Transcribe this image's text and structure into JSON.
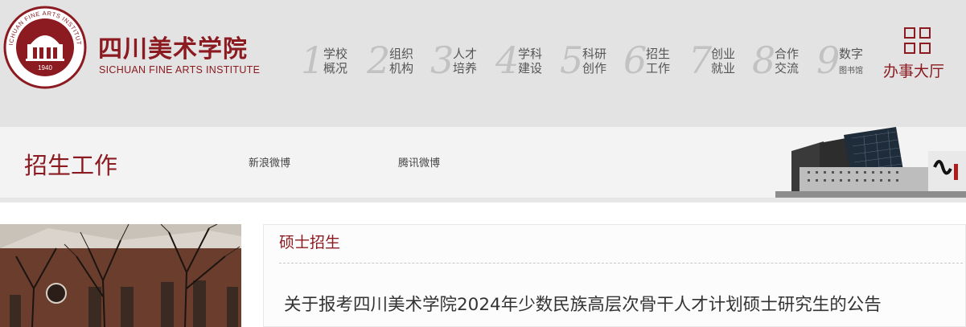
{
  "header": {
    "seal": {
      "year": "1940",
      "ring_text": "SICHUAN FINE ARTS INSTITUTE"
    },
    "logo_cn": "四川美术学院",
    "logo_en": "SICHUAN FINE ARTS INSTITUTE",
    "nav": [
      {
        "num": "1",
        "line1": "学校",
        "line2": "概况"
      },
      {
        "num": "2",
        "line1": "组织",
        "line2": "机构"
      },
      {
        "num": "3",
        "line1": "人才",
        "line2": "培养"
      },
      {
        "num": "4",
        "line1": "学科",
        "line2": "建设"
      },
      {
        "num": "5",
        "line1": "科研",
        "line2": "创作"
      },
      {
        "num": "6",
        "line1": "招生",
        "line2": "工作"
      },
      {
        "num": "7",
        "line1": "创业",
        "line2": "就业"
      },
      {
        "num": "8",
        "line1": "合作",
        "line2": "交流"
      },
      {
        "num": "9",
        "line1": "数字",
        "line2": "图书馆"
      }
    ],
    "office_label": "办事大厅"
  },
  "band": {
    "section_title": "招生工作",
    "links": [
      "新浪微博",
      "腾讯微博"
    ]
  },
  "main": {
    "category": "硕士招生",
    "article_title": "关于报考四川美术学院2024年少数民族高层次骨干人才计划硕士研究生的公告"
  },
  "colors": {
    "brand": "#8b1b21",
    "header_bg": "#e3e3e3",
    "band_bg": "#f3f3f3"
  }
}
